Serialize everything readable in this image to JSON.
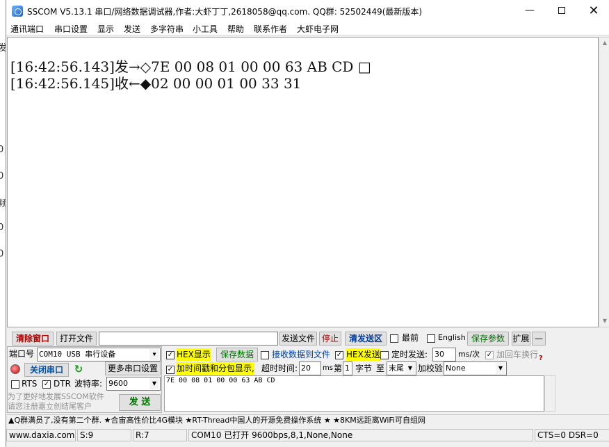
{
  "background_window": {
    "glyphs": [
      "发",
      "|",
      ",",
      "0",
      "0",
      "频",
      "0",
      "0"
    ]
  },
  "window": {
    "title": "SSCOM V5.13.1 串口/网络数据调试器,作者:大虾丁丁,2618058@qq.com. QQ群: 52502449(最新版本)",
    "min_glyph": "—",
    "close_glyph": "✕"
  },
  "menu": {
    "items": [
      "通讯端口",
      "串口设置",
      "显示",
      "发送",
      "多字符串",
      "小工具",
      "帮助",
      "联系作者",
      "大虾电子网"
    ]
  },
  "receive": {
    "lines": [
      "[16:42:56.143]发→◇7E 00 08 01 00 00 63 AB CD □",
      "[16:42:56.145]收←◆02 00 00 01 00 33 31"
    ]
  },
  "toolbar": {
    "clear_window": "清除窗口",
    "open_file": "打开文件",
    "file_path": "",
    "send_file": "发送文件",
    "stop": "停止",
    "clear_send": "清发送区",
    "topmost": "最前",
    "english": "English",
    "save_params": "保存参数",
    "expand": "扩展",
    "collapse": "—"
  },
  "port": {
    "port_label": "端口号",
    "port_value": "COM10 USB 串行设备",
    "more_settings": "更多串口设置",
    "close_port": "关闭串口",
    "rts": "RTS",
    "dtr": "DTR",
    "baud_label": "波特率:",
    "baud_value": "9600",
    "promo_line1": "为了更好地发展SSCOM软件",
    "promo_line2": "请您注册嘉立创结尾客户",
    "send": "发 送"
  },
  "options": {
    "hex_display": "HEX显示",
    "save_data": "保存数据",
    "recv_to_file": "接收数据到文件",
    "hex_send": "HEX发送",
    "timed_send": "定时发送:",
    "interval": "30",
    "interval_unit": "ms/次",
    "append_crlf": "加回车换行",
    "timestamp": "加时间戳和分包显示,",
    "timeout_label": "超时时间:",
    "timeout_value": "20",
    "timeout_unit": "ms",
    "byte_index_prefix": "第",
    "byte_index": "1",
    "byte_unit": "字节",
    "to": "至",
    "to_value": "末尾",
    "checksum_label": "加校验",
    "checksum_value": "None"
  },
  "send_area": {
    "text": "7E 00 08 01 00 00 63 AB CD"
  },
  "marquee": "▲Q群满员了,没有第二个群. ★合宙高性价比4G模块 ★RT-Thread中国人的开源免费操作系统 ★ ★8KM远距离WiFi可自组网",
  "status": {
    "website": "www.daxia.com",
    "sent": "S:9",
    "received": "R:7",
    "port_state": "COM10 已打开  9600bps,8,1,None,None",
    "signals": "CTS=0 DSR=0"
  }
}
